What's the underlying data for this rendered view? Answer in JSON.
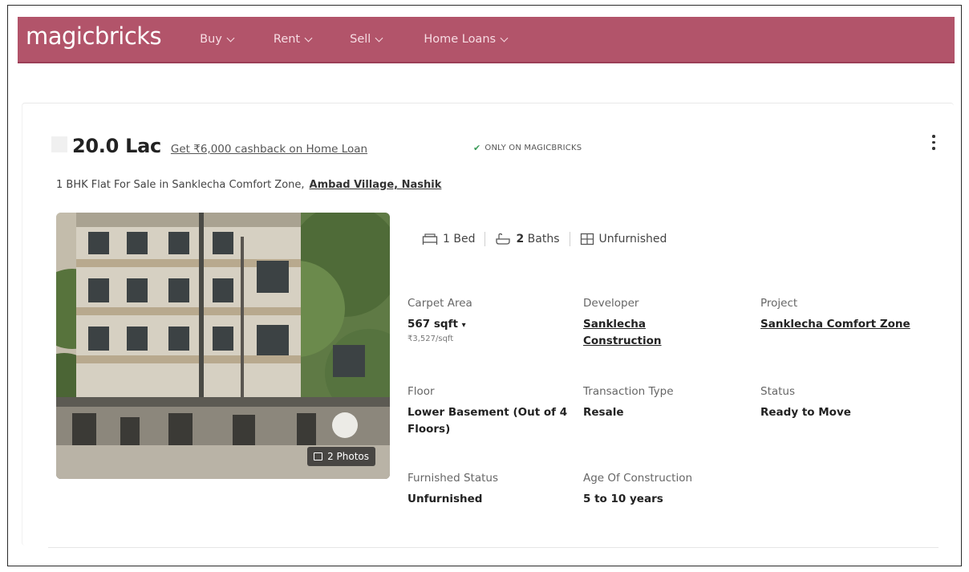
{
  "navbar": {
    "logo": "magicbricks",
    "items": [
      {
        "label": "Buy"
      },
      {
        "label": "Rent"
      },
      {
        "label": "Sell"
      },
      {
        "label": "Home Loans"
      }
    ]
  },
  "listing": {
    "price": "20.0 Lac",
    "cashback": "Get ₹6,000 cashback on Home Loan",
    "exclusive_badge": "ONLY ON MAGICBRICKS",
    "title": "1 BHK Flat For Sale in Sanklecha Comfort Zone,",
    "locality": "Ambad Village, Nashik",
    "photos_label": "2 Photos",
    "amenities": {
      "bed": "1 Bed",
      "bath_count": "2",
      "bath_label": "Baths",
      "furnishing": "Unfurnished"
    },
    "details": {
      "carpet_area_label": "Carpet Area",
      "carpet_area_value": "567 sqft",
      "carpet_area_dropdown": "▾",
      "price_per_sqft": "₹3,527/sqft",
      "developer_label": "Developer",
      "developer_value": "Sanklecha Construction",
      "project_label": "Project",
      "project_value": "Sanklecha Comfort Zone",
      "floor_label": "Floor",
      "floor_value": "Lower Basement (Out of 4 Floors)",
      "transaction_label": "Transaction Type",
      "transaction_value": "Resale",
      "status_label": "Status",
      "status_value": "Ready to Move",
      "furnished_label": "Furnished Status",
      "furnished_value": "Unfurnished",
      "age_label": "Age Of Construction",
      "age_value": "5 to 10 years"
    }
  },
  "colors": {
    "navbar": "#b2546a",
    "badge_check": "#3a9b58"
  }
}
